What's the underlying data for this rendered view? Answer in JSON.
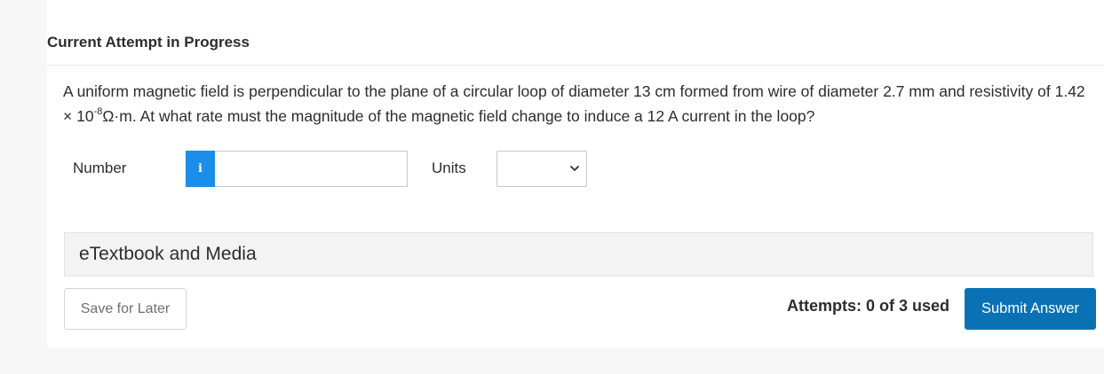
{
  "heading": "Current Attempt in Progress",
  "question": {
    "part1": "A uniform magnetic field is perpendicular to the plane of a circular loop of diameter 13 cm formed from wire of diameter 2.7 mm and resistivity of 1.42 × 10",
    "exponent": "-8",
    "part2": "Ω·m. At what rate must the magnitude of the magnetic field change to induce a 12 A current in the loop?"
  },
  "answer": {
    "number_label": "Number",
    "info_icon_glyph": "i",
    "number_value": "",
    "units_label": "Units",
    "units_selected": ""
  },
  "etextbook": {
    "label": "eTextbook and Media"
  },
  "footer": {
    "save_label": "Save for Later",
    "attempts_text": "Attempts: 0 of 3 used",
    "submit_label": "Submit Answer"
  },
  "colors": {
    "info_icon_bg": "#1a8ee8",
    "submit_bg": "#0a72b4",
    "page_bg": "#f7f7f7"
  }
}
